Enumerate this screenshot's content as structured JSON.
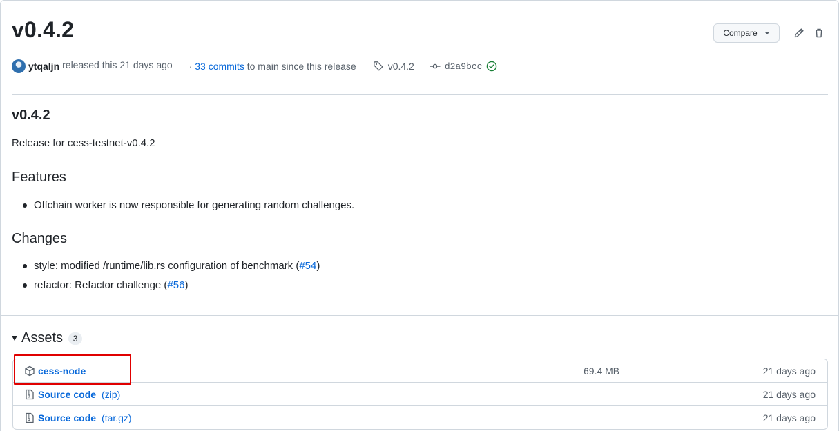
{
  "release": {
    "title": "v0.4.2",
    "compare_label": "Compare",
    "author": "ytqaljn",
    "released_text": "released this 21 days ago",
    "commits_prefix": "·",
    "commits_link": "33 commits",
    "commits_suffix": "to main since this release",
    "tag": "v0.4.2",
    "commit_sha": "d2a9bcc"
  },
  "notes": {
    "heading": "v0.4.2",
    "description": "Release for cess-testnet-v0.4.2",
    "features_heading": "Features",
    "features": [
      "Offchain worker is now responsible for generating random challenges."
    ],
    "changes_heading": "Changes",
    "changes": [
      {
        "text": "style: modified /runtime/lib.rs configuration of benchmark (",
        "link": "#54",
        "close": ")"
      },
      {
        "text": "refactor: Refactor challenge (",
        "link": "#56",
        "close": ")"
      }
    ]
  },
  "assets": {
    "heading": "Assets",
    "count": "3",
    "items": [
      {
        "name": "cess-node",
        "sub": "",
        "size": "69.4 MB",
        "date": "21 days ago",
        "icon": "package-icon"
      },
      {
        "name": "Source code",
        "sub": "(zip)",
        "size": "",
        "date": "21 days ago",
        "icon": "file-zip-icon"
      },
      {
        "name": "Source code",
        "sub": "(tar.gz)",
        "size": "",
        "date": "21 days ago",
        "icon": "file-zip-icon"
      }
    ]
  },
  "colors": {
    "link": "#0969da",
    "success": "#1a7f37",
    "highlight": "#e00000"
  }
}
